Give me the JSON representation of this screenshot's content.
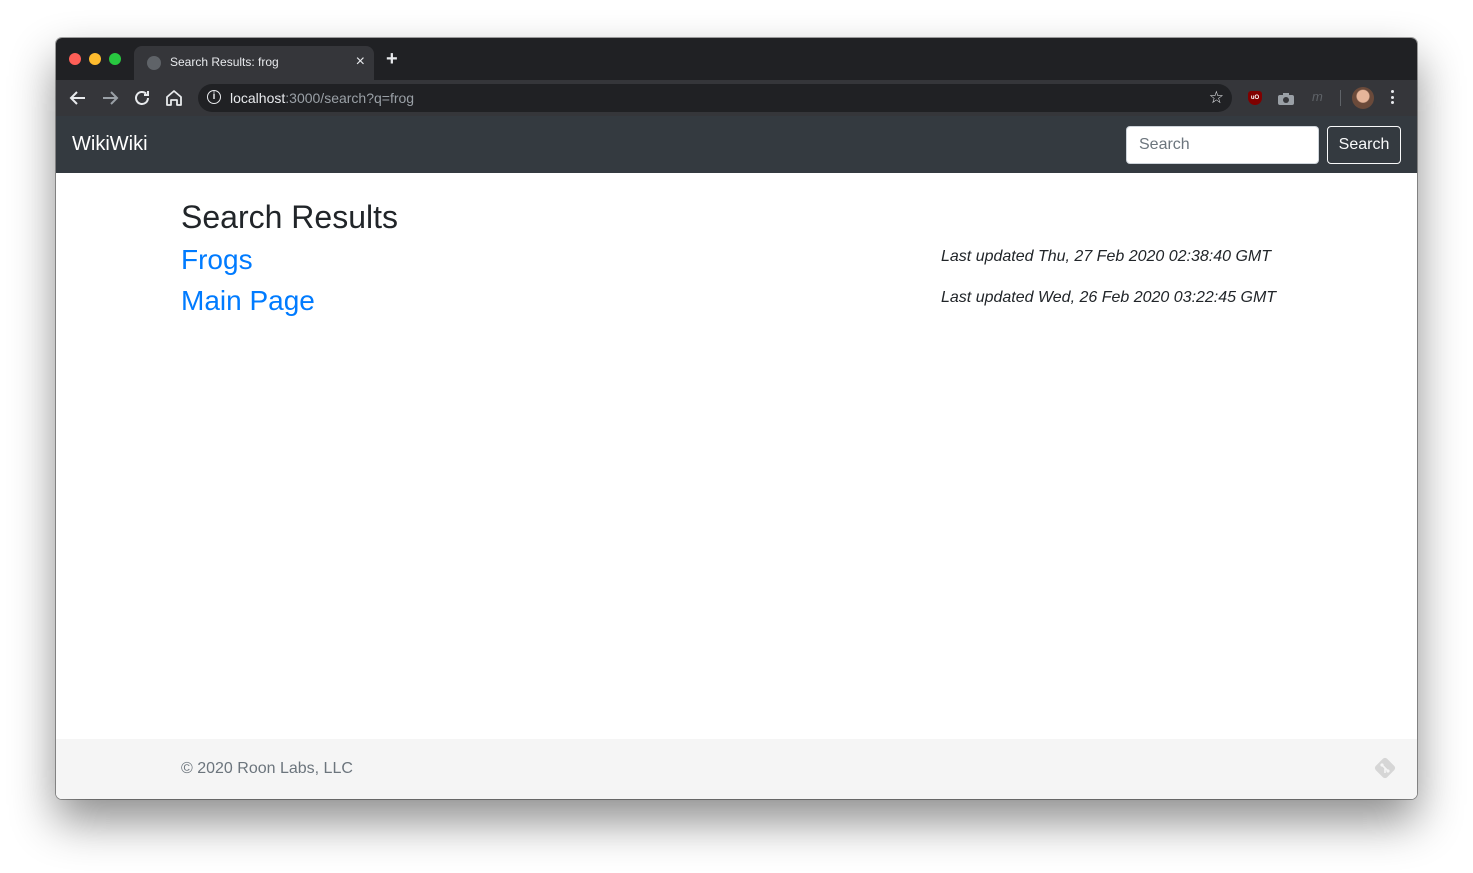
{
  "browser": {
    "tab_title": "Search Results: frog",
    "tab_close": "×",
    "new_tab": "+",
    "url_host": "localhost",
    "url_path": ":3000/search?q=frog",
    "ext_m_label": "m"
  },
  "navbar": {
    "brand": "WikiWiki",
    "search_placeholder": "Search",
    "search_button": "Search"
  },
  "main": {
    "title": "Search Results",
    "results": [
      {
        "title": "Frogs",
        "updated": "Last updated Thu, 27 Feb 2020 02:38:40 GMT"
      },
      {
        "title": "Main Page",
        "updated": "Last updated Wed, 26 Feb 2020 03:22:45 GMT"
      }
    ]
  },
  "footer": {
    "copyright": "© 2020 Roon Labs, LLC"
  }
}
